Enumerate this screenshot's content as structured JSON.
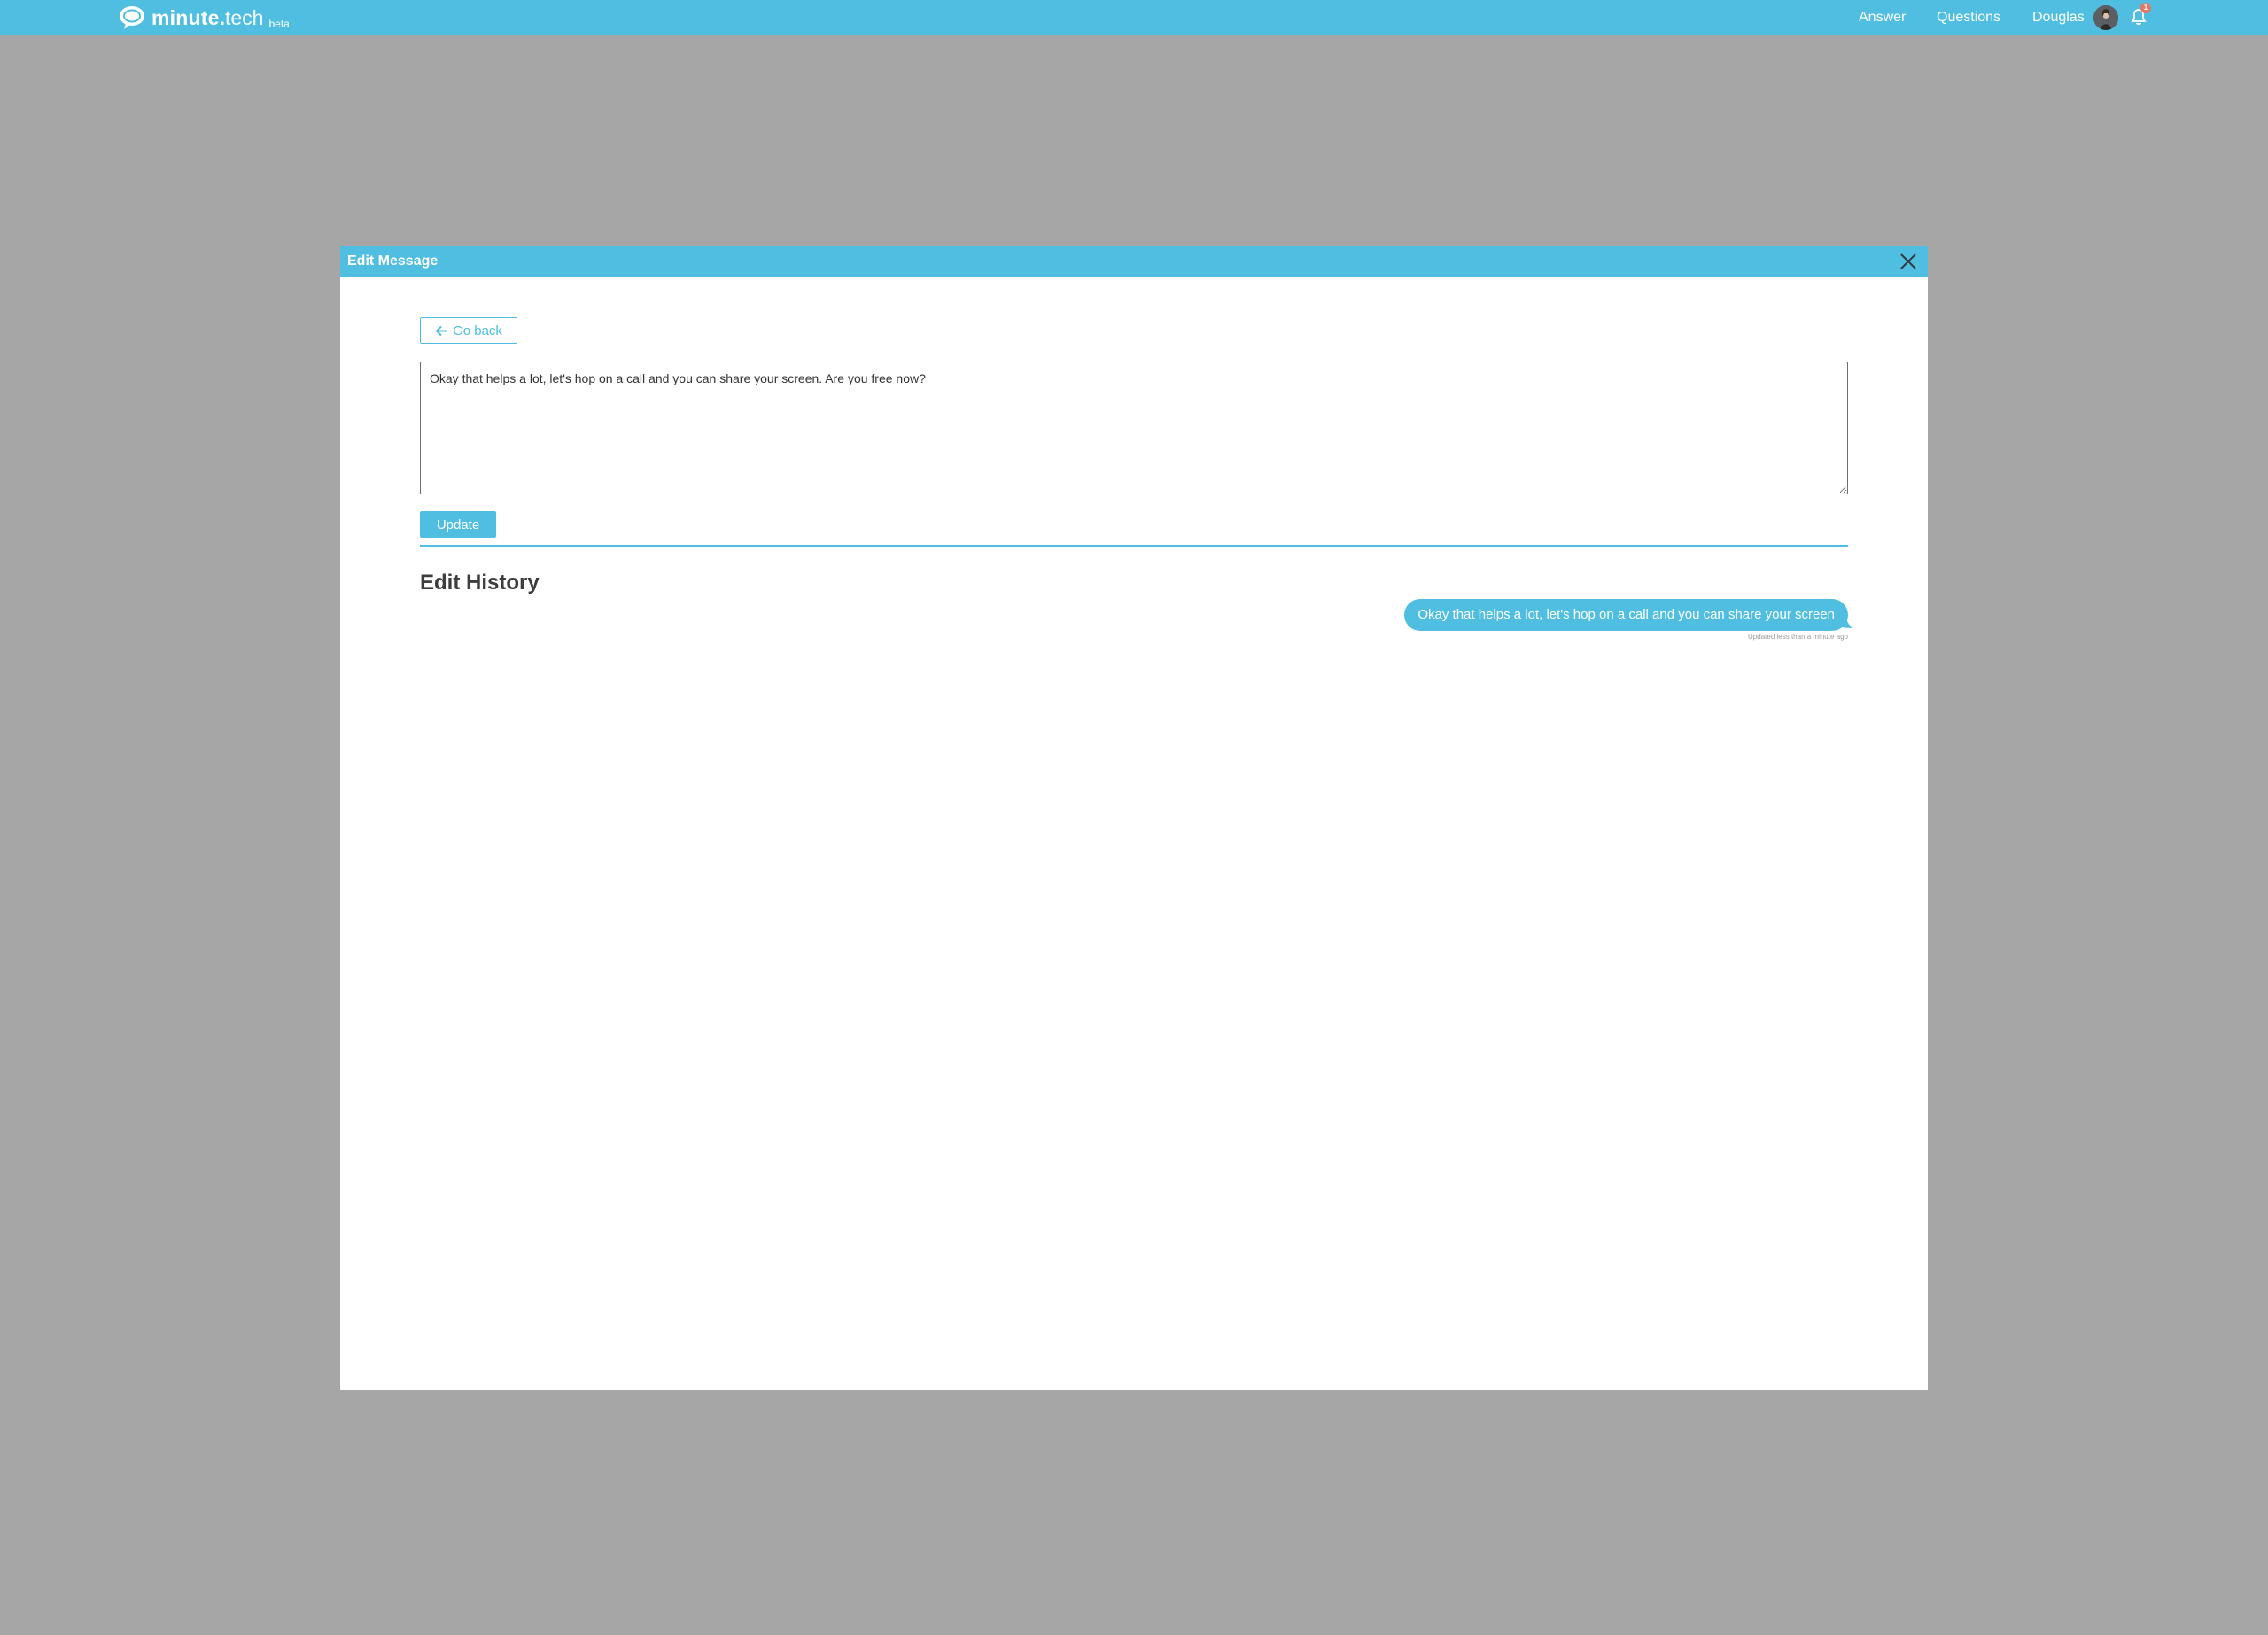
{
  "brand": {
    "name_bold": "minute",
    "name_dot": ".",
    "name_light": "tech",
    "badge": "beta"
  },
  "nav": {
    "answer": "Answer",
    "questions": "Questions",
    "user": "Douglas",
    "notification_count": "1"
  },
  "modal": {
    "title": "Edit Message",
    "go_back_label": "Go back",
    "message_text": "Okay that helps a lot, let's hop on a call and you can share your screen. Are you free now?",
    "update_label": "Update",
    "history_heading": "Edit History",
    "history": [
      {
        "text": "Okay that helps a lot, let's hop on a call and you can share your screen",
        "meta": "Updated less than a minute ago"
      }
    ]
  },
  "colors": {
    "accent": "#4fbee0",
    "backdrop": "#a6a6a6",
    "badge": "#e27866"
  },
  "icons": {
    "logo": "speech-bubble-icon",
    "back": "arrow-left-icon",
    "close": "close-icon",
    "bell": "bell-icon"
  }
}
